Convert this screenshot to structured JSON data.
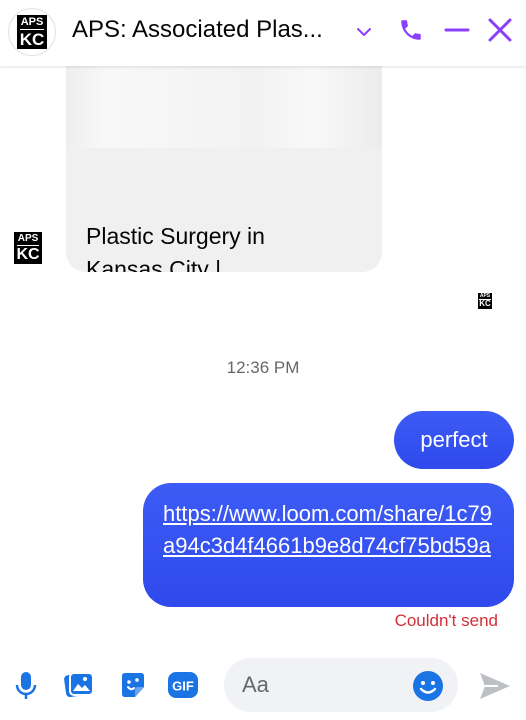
{
  "header": {
    "avatar_logo_top": "APS",
    "avatar_logo_bottom": "KC",
    "title": "APS: Associated Plas...",
    "icons": [
      "chevron-down-icon",
      "phone-icon",
      "minimize-icon",
      "close-icon"
    ]
  },
  "messages": {
    "link_card": {
      "title": "Plastic Surgery in\nKansas City |\nExperienced Plastic ..."
    },
    "sender_logo_top": "APS",
    "sender_logo_bottom": "KC",
    "timestamp": "12:36 PM",
    "outgoing": [
      {
        "text": "perfect"
      },
      {
        "text": "https://www.loom.com/share/1c79a94c3d4f4661b9e8d74cf75bd59a"
      }
    ],
    "error": "Couldn't send"
  },
  "composer": {
    "placeholder": "Aa",
    "icons": [
      "microphone-icon",
      "photo-icon",
      "sticker-icon",
      "gif-icon",
      "emoji-icon",
      "send-icon"
    ]
  },
  "colors": {
    "accent": "#8a3ffc",
    "bubble": "#3a55f2",
    "error": "#d32f3a",
    "composer_icon": "#1b74e4"
  }
}
